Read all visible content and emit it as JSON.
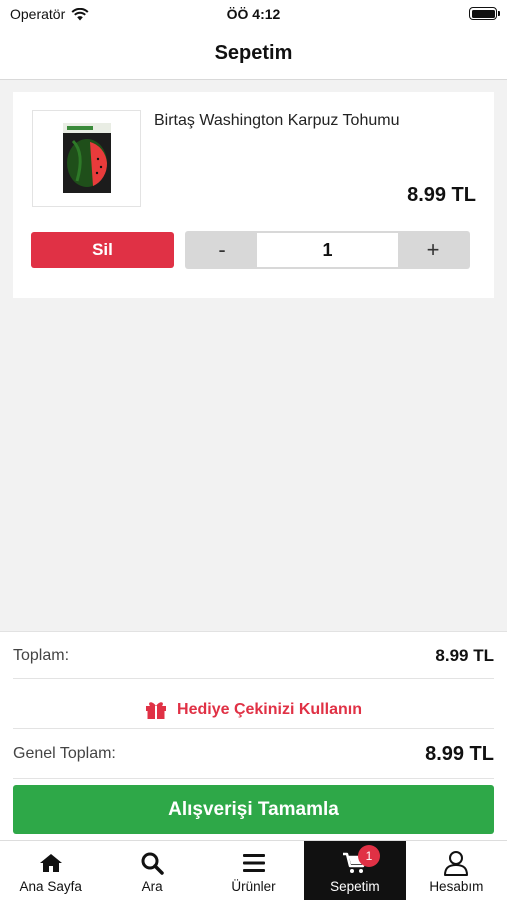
{
  "status_bar": {
    "carrier": "Operatör",
    "time": "ÖÖ 4:12"
  },
  "header": {
    "title": "Sepetim"
  },
  "cart": {
    "items": [
      {
        "name": "Birtaş Washington Karpuz Tohumu",
        "price": "8.99 TL",
        "quantity": "1",
        "delete_label": "Sil",
        "minus_label": "-",
        "plus_label": "+"
      }
    ]
  },
  "summary": {
    "subtotal_label": "Toplam:",
    "subtotal_value": "8.99 TL",
    "gift_label": "Hediye Çekinizi Kullanın",
    "total_label": "Genel Toplam:",
    "total_value": "8.99 TL",
    "checkout_label": "Alışverişi Tamamla"
  },
  "tabbar": {
    "items": [
      {
        "label": "Ana Sayfa",
        "icon": "home-icon"
      },
      {
        "label": "Ara",
        "icon": "search-icon"
      },
      {
        "label": "Ürünler",
        "icon": "menu-icon"
      },
      {
        "label": "Sepetim",
        "icon": "cart-icon",
        "badge": "1",
        "active": true
      },
      {
        "label": "Hesabım",
        "icon": "user-icon"
      }
    ]
  },
  "colors": {
    "danger": "#e03145",
    "success": "#2ea848",
    "active_tab": "#111111"
  }
}
